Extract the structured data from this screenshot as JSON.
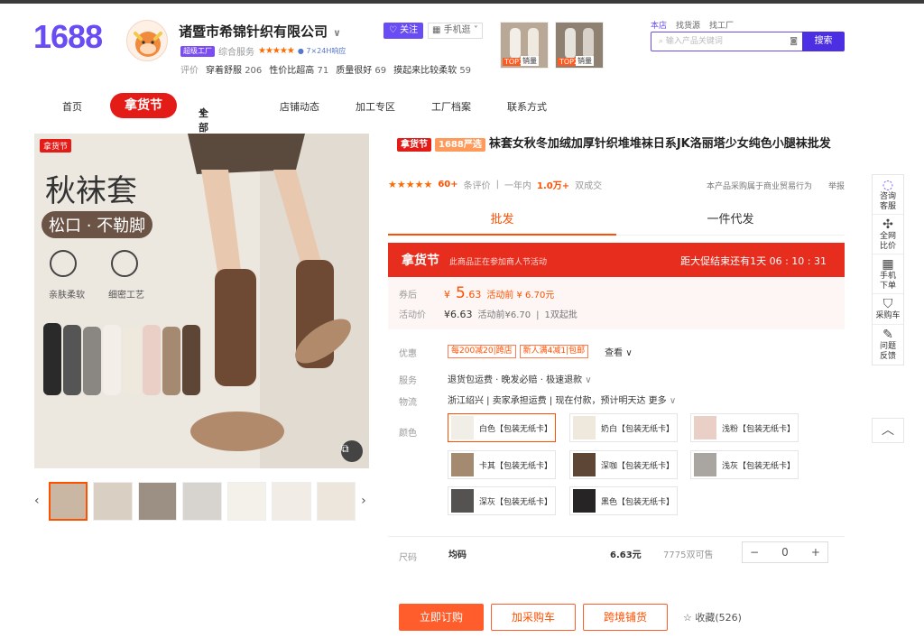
{
  "header": {
    "logo": "1688",
    "shop_name": "诸暨市希锦针织有限公司",
    "follow_label": "关注",
    "mobile_label": "手机逛",
    "badge_super": "超级工厂",
    "overall_label": "综合服务",
    "badge_7x24": "7×24H响应",
    "score_label": "评价",
    "scores": [
      {
        "label": "穿着舒服",
        "num": "206"
      },
      {
        "label": "性价比超高",
        "num": "71"
      },
      {
        "label": "质量很好",
        "num": "69"
      },
      {
        "label": "摸起来比较柔软",
        "num": "59"
      }
    ],
    "top_items": [
      {
        "tag": "TOP1",
        "sub": "销量"
      },
      {
        "tag": "TOP2",
        "sub": "销量"
      }
    ],
    "search_tabs": [
      "本店",
      "找货源",
      "找工厂"
    ],
    "search_placeholder": "输入产品关键词",
    "search_button": "搜索"
  },
  "nav": {
    "items": [
      "首页",
      "拿货节",
      "全部商品",
      "店铺动态",
      "加工专区",
      "工厂档案",
      "联系方式"
    ]
  },
  "main_image": {
    "corner_tag": "拿货节",
    "headline": "秋袜套",
    "subline": "松口 · 不勒脚",
    "feat1": "亲肤柔软",
    "feat2": "细密工艺"
  },
  "product": {
    "tag1": "拿货节",
    "tag2": "1688严选",
    "title": "袜套女秋冬加绒加厚针织堆堆袜日系JK洛丽塔少女纯色小腿袜批发",
    "review_count": "60+",
    "review_suffix": "条评价",
    "year_label": "一年内",
    "deals": "1.0万+",
    "deals_suffix": "双成交",
    "trade_note": "本产品采购属于商业贸易行为",
    "report": "举报",
    "tab_wholesale": "批发",
    "tab_dropship": "一件代发"
  },
  "promo": {
    "label": "拿货节",
    "desc": "此商品正在参加商人节活动",
    "countdown": "距大促结束还有1天 06 : 10 : 31"
  },
  "prices": {
    "coupon_label": "券后",
    "currency": "¥",
    "coupon_price_int": "5",
    "coupon_price_dec": ".63",
    "coupon_before": "活动前 ¥ 6.70元",
    "activity_label": "活动价",
    "activity_price": "¥6.63",
    "activity_before": "活动前¥6.70",
    "min_order": "1双起批"
  },
  "details": {
    "discount_label": "优惠",
    "coupons": [
      "每200减20|跨店",
      "新人满4减1|包邮"
    ],
    "coupon_more": "查看",
    "service_label": "服务",
    "service_text": "退货包运费 · 晚发必赔 · 极速退款",
    "logistics_label": "物流",
    "logistics_text": "浙江绍兴 | 卖家承担运费 | 现在付款，预计明天达 更多",
    "color_label": "颜色",
    "colors": [
      {
        "name": "白色【包装无纸卡】",
        "swatch": "#f1eee8"
      },
      {
        "name": "奶白【包装无纸卡】",
        "swatch": "#efe8dc"
      },
      {
        "name": "浅粉【包装无纸卡】",
        "swatch": "#e9cfc6"
      },
      {
        "name": "卡其【包装无纸卡】",
        "swatch": "#a58a72"
      },
      {
        "name": "深咖【包装无纸卡】",
        "swatch": "#5e4636"
      },
      {
        "name": "浅灰【包装无纸卡】",
        "swatch": "#a9a6a2"
      },
      {
        "name": "深灰【包装无纸卡】",
        "swatch": "#555352"
      },
      {
        "name": "黑色【包装无纸卡】",
        "swatch": "#262424"
      }
    ],
    "size_label": "尺码",
    "size_value": "均码",
    "size_price": "6.63元",
    "stock": "7775双可售",
    "quantity": "0"
  },
  "actions": {
    "buy": "立即订购",
    "cart": "加采购车",
    "cross": "跨境铺货",
    "fav": "收藏(526)"
  },
  "sidebar": [
    {
      "l1": "咨询",
      "l2": "客服"
    },
    {
      "l1": "全网",
      "l2": "比价"
    },
    {
      "l1": "手机",
      "l2": "下单"
    },
    {
      "l1": "采购车",
      "l2": ""
    },
    {
      "l1": "问题",
      "l2": "反馈"
    }
  ]
}
